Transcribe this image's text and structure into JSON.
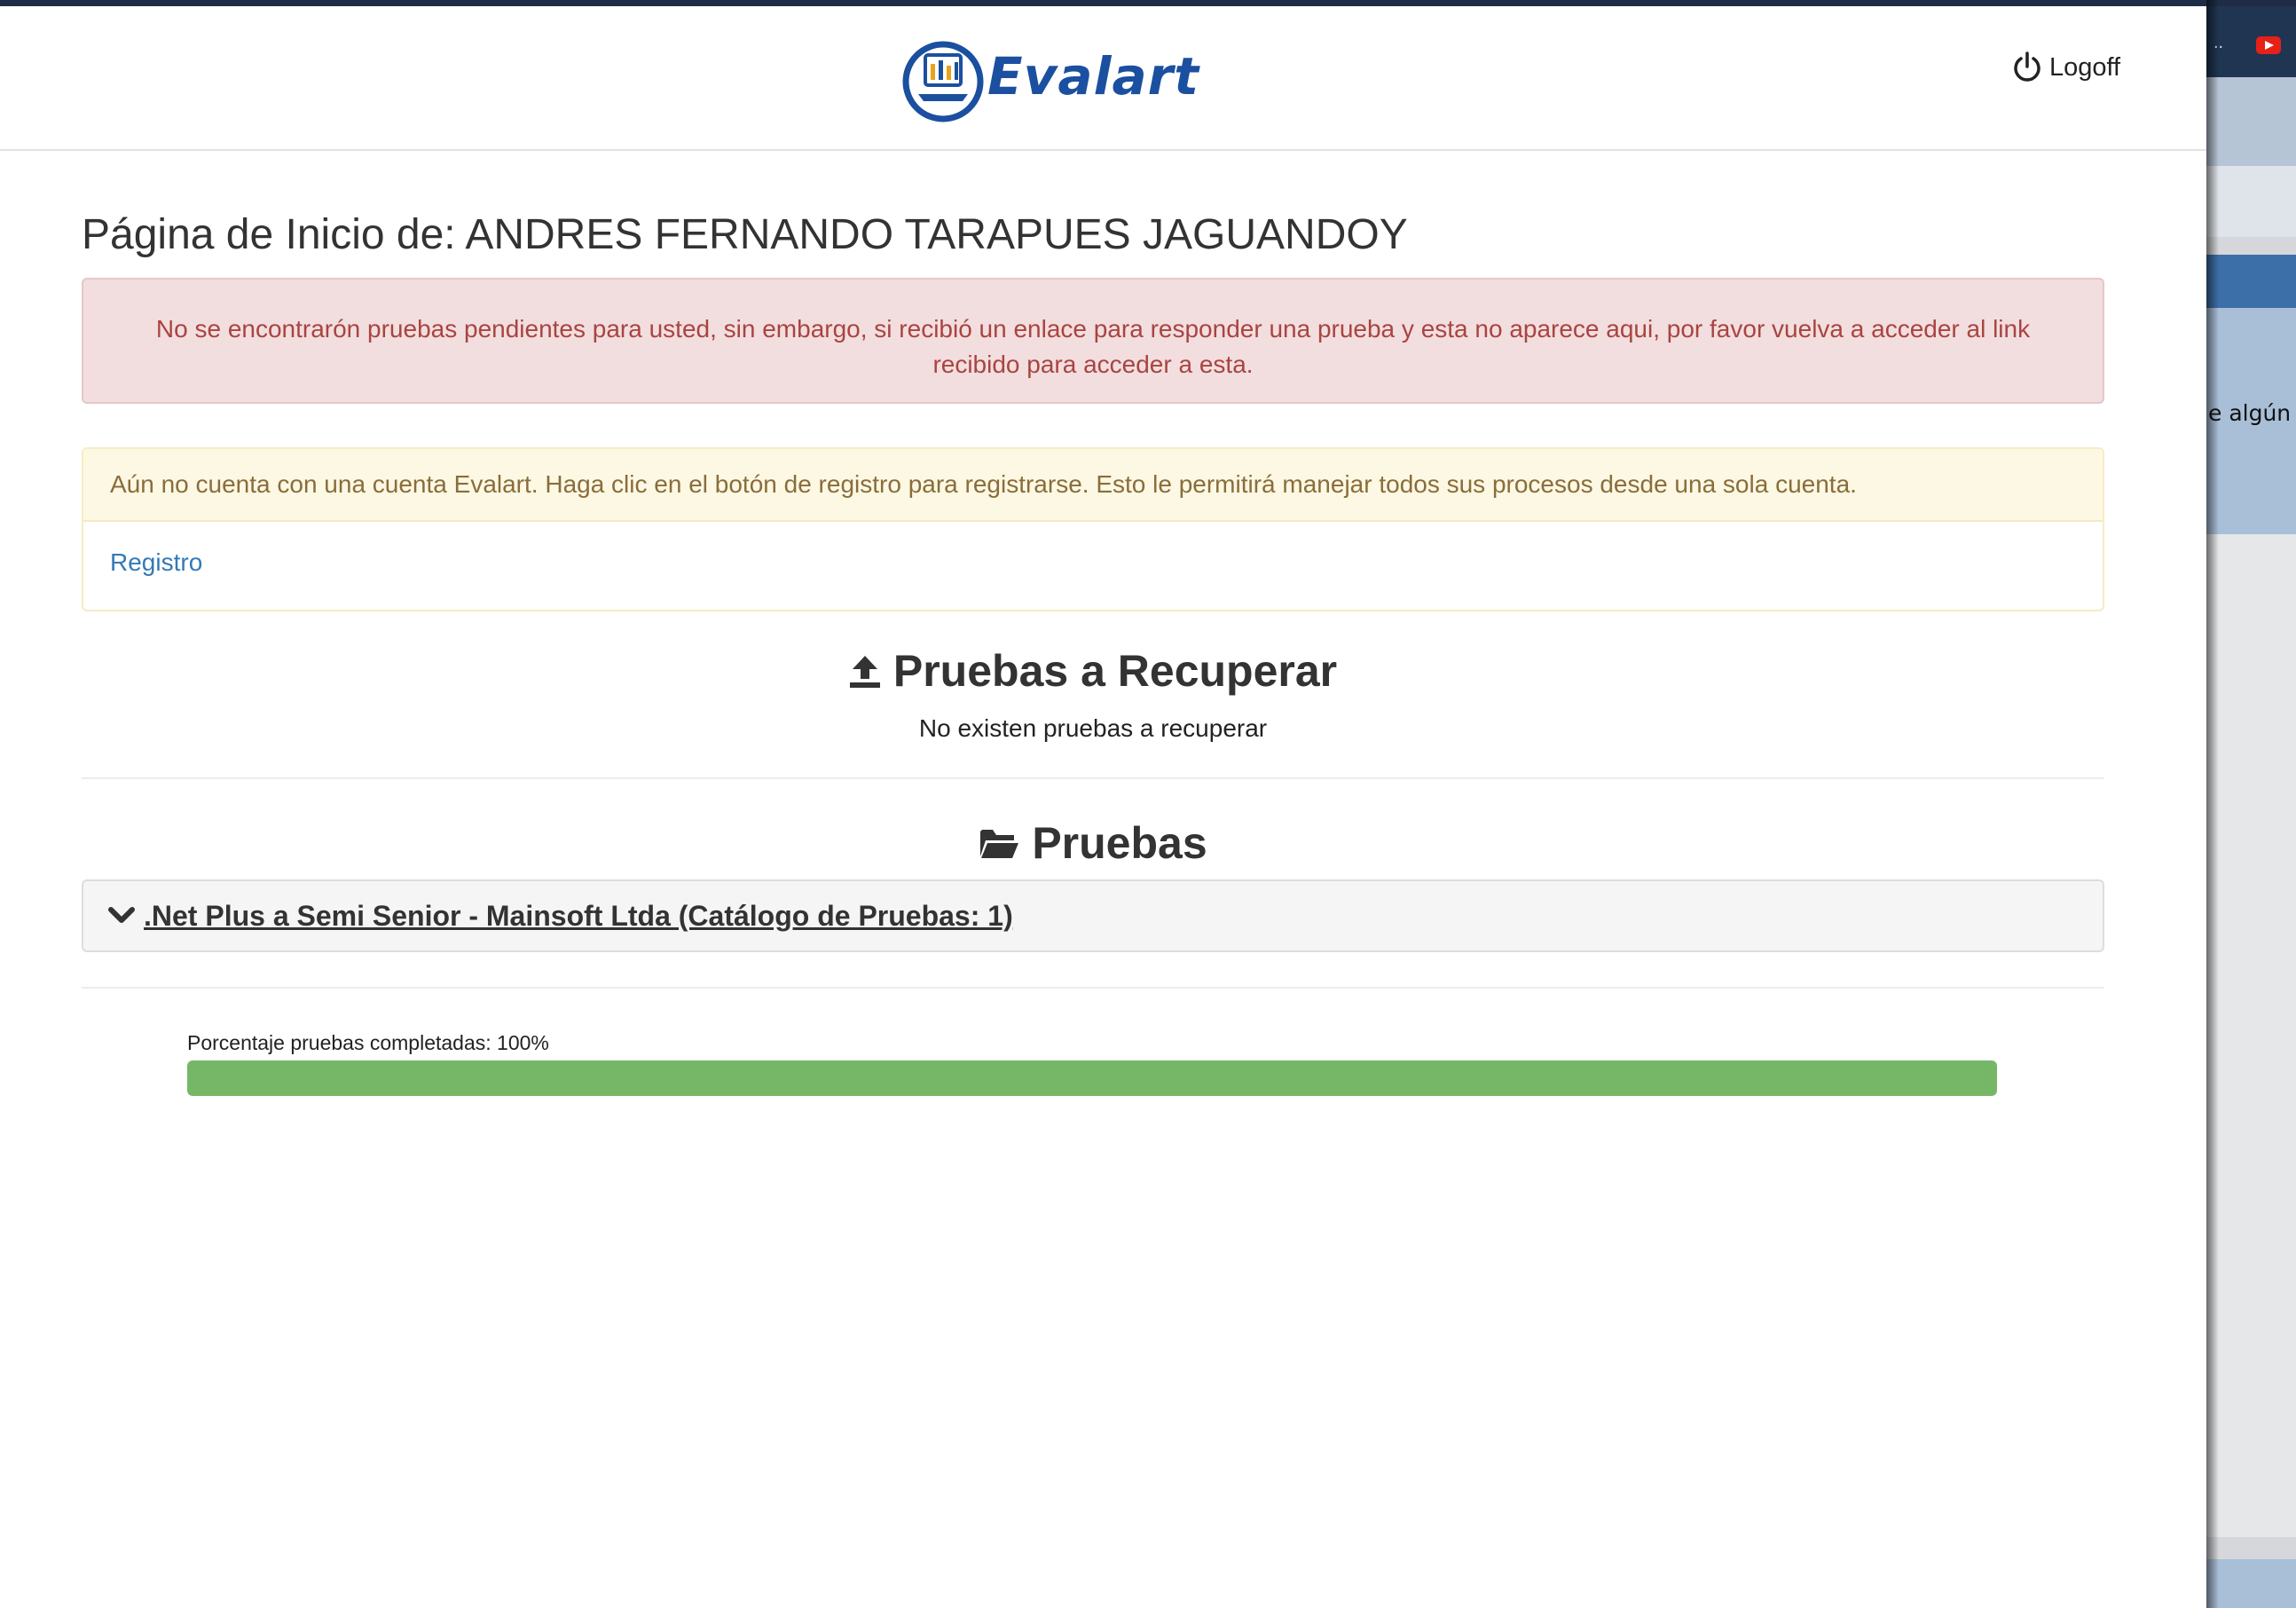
{
  "header": {
    "logo_text": "Evalart",
    "logoff_label": "Logoff"
  },
  "page_title": "Página de Inicio de: ANDRES FERNANDO TARAPUES JAGUANDOY",
  "alerts": {
    "danger_text": "No se encontrarón pruebas pendientes para usted, sin embargo, si recibió un enlace para responder una prueba y esta no aparece aqui, por favor vuelva a acceder al link recibido para acceder a esta.",
    "warning_text": "Aún no cuenta con una cuenta Evalart. Haga clic en el botón de registro para registrarse. Esto le permitirá manejar todos sus procesos desde una sola cuenta.",
    "register_link": "Registro"
  },
  "recover": {
    "title": "Pruebas a Recuperar",
    "empty_text": "No existen pruebas a recuperar"
  },
  "tests": {
    "title": "Pruebas",
    "groups": [
      {
        "label": ".Net Plus a Semi Senior - Mainsoft Ltda (Catálogo de Pruebas: 1)"
      }
    ]
  },
  "progress": {
    "label": "Porcentaje pruebas completadas: 100%",
    "percent": 100,
    "color": "#75b766"
  },
  "background_window": {
    "partial_text": "e algún"
  },
  "colors": {
    "brand": "#1b4fa0",
    "danger_text": "#a94442",
    "danger_bg": "#f2dede",
    "warning_text": "#8a6d3b",
    "warning_bg": "#fcf8e3",
    "link": "#337ab7"
  }
}
